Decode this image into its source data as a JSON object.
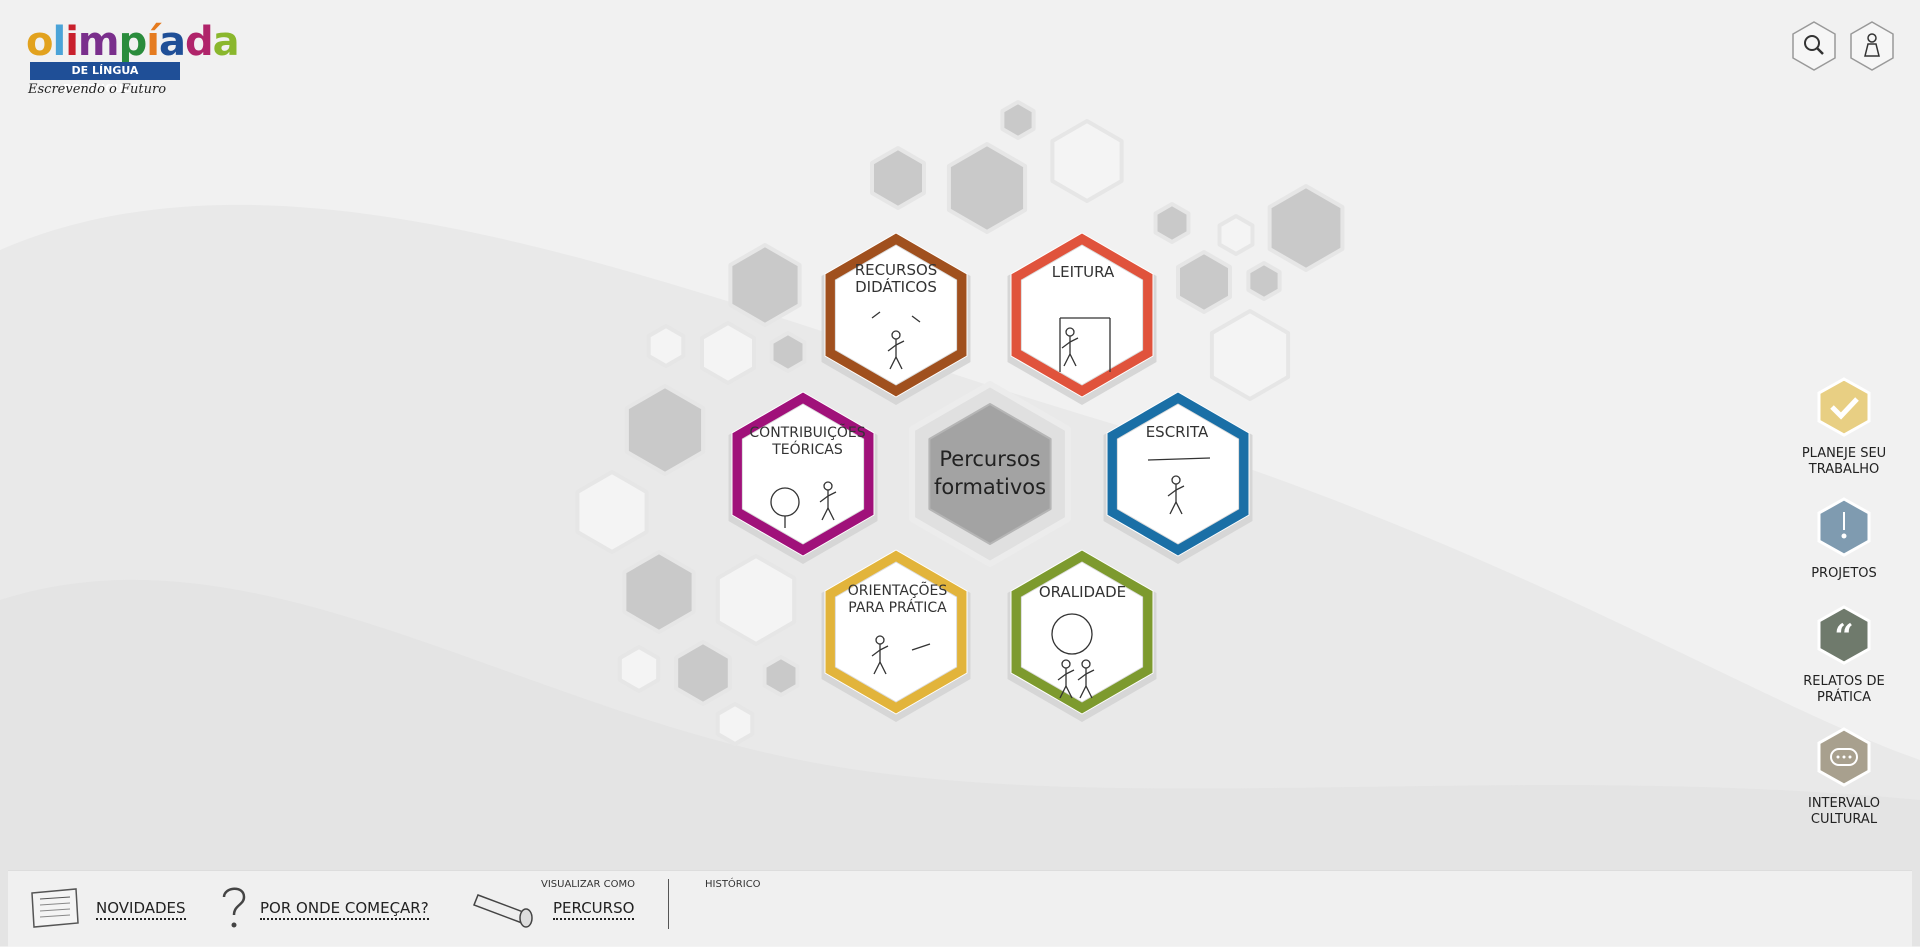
{
  "logo": {
    "word": "olimpíada",
    "band": "DE LÍNGUA PORTUGUESA",
    "script": "Escrevendo o Futuro"
  },
  "top_icons": [
    "search-icon",
    "user-icon"
  ],
  "center": {
    "line1": "Percursos",
    "line2": "formativos"
  },
  "hexes": [
    {
      "line1": "RECURSOS",
      "line2": "DIDÁTICOS",
      "color": "#a0501e"
    },
    {
      "line1": "LEITURA",
      "line2": "",
      "color": "#e0533c"
    },
    {
      "line1": "CONTRIBUIÇÕES",
      "line2": "TEÓRICAS",
      "color": "#a0117a"
    },
    {
      "line1": "ESCRITA",
      "line2": "",
      "color": "#1a6fa6"
    },
    {
      "line1": "ORIENTAÇÕES",
      "line2": "PARA PRÁTICA",
      "color": "#e2b43b"
    },
    {
      "line1": "ORALIDADE",
      "line2": "",
      "color": "#7d9a2e"
    }
  ],
  "side": [
    {
      "line1": "PLANEJE SEU",
      "line2": "TRABALHO",
      "color": "#e8cf83",
      "icon": "check-icon"
    },
    {
      "line1": "PROJETOS",
      "line2": "",
      "color": "#7f9bb0",
      "icon": "clock-icon"
    },
    {
      "line1": "RELATOS DE",
      "line2": "PRÁTICA",
      "color": "#6f7a6c",
      "icon": "quote-icon"
    },
    {
      "line1": "INTERVALO",
      "line2": "CULTURAL",
      "color": "#a8a08e",
      "icon": "chat-icon"
    }
  ],
  "footer": {
    "novidades": "NOVIDADES",
    "por_onde": "POR ONDE COMEÇAR?",
    "visualizar": "VISUALIZAR COMO",
    "percurso": "PERCURSO",
    "historico": "HISTÓRICO"
  }
}
